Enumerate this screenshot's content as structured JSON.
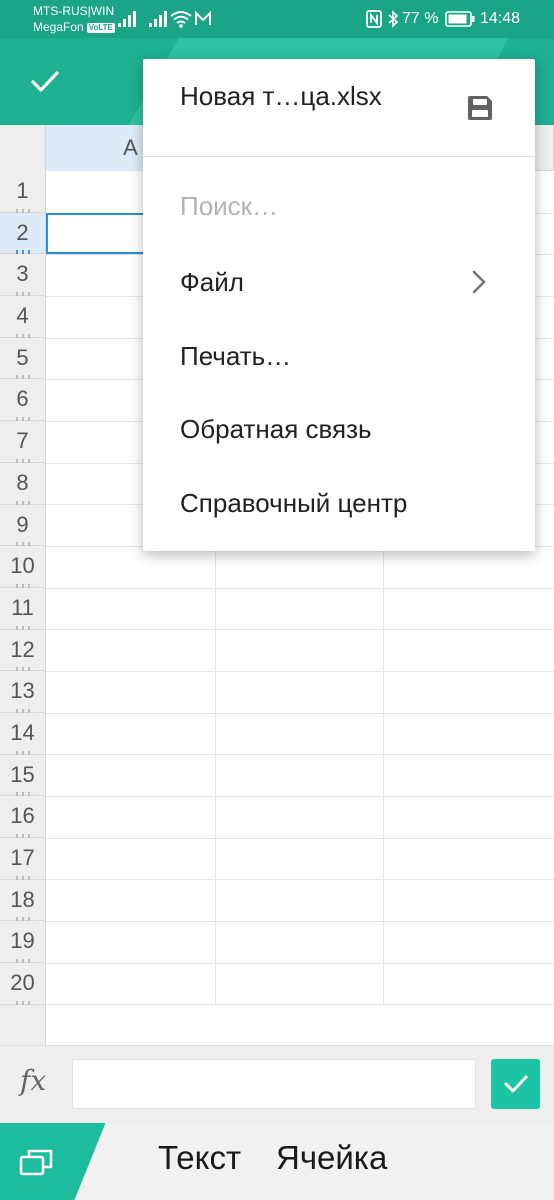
{
  "status_bar": {
    "carrier1": "MTS-RUS|WIN",
    "carrier2": "MegaFon",
    "volte": "VoLTE",
    "battery": "77 %",
    "time": "14:48"
  },
  "spreadsheet": {
    "columns": [
      {
        "label": "A",
        "selected": true
      },
      {
        "label": "",
        "selected": false
      },
      {
        "label": "",
        "selected": false
      }
    ],
    "rows": [
      "1",
      "2",
      "3",
      "4",
      "5",
      "6",
      "7",
      "8",
      "9",
      "10",
      "11",
      "12",
      "13",
      "14",
      "15",
      "16",
      "17",
      "18",
      "19",
      "20"
    ],
    "selected_row": "2",
    "selected_cell": "A2"
  },
  "formula_bar": {
    "fx_label": "fx",
    "value": ""
  },
  "bottom_tabs": [
    "Текст",
    "Ячейка"
  ],
  "menu": {
    "title": "Новая т…ца.xlsx",
    "search_placeholder": "Поиск…",
    "items": [
      {
        "label": "Файл",
        "has_submenu": true
      },
      {
        "label": "Печать…",
        "has_submenu": false
      },
      {
        "label": "Обратная связь",
        "has_submenu": false
      },
      {
        "label": "Справочный центр",
        "has_submenu": false
      }
    ]
  },
  "colors": {
    "brand": "#1fb092",
    "accent": "#1cc4a3",
    "selection": "#2a8fd6"
  },
  "icons": [
    "checkmark-icon",
    "floppy-disk-icon",
    "chevron-right-icon",
    "windows-icon",
    "nfc-icon",
    "bluetooth-icon",
    "wifi-icon",
    "signal-icon",
    "battery-icon",
    "mail-icon"
  ]
}
